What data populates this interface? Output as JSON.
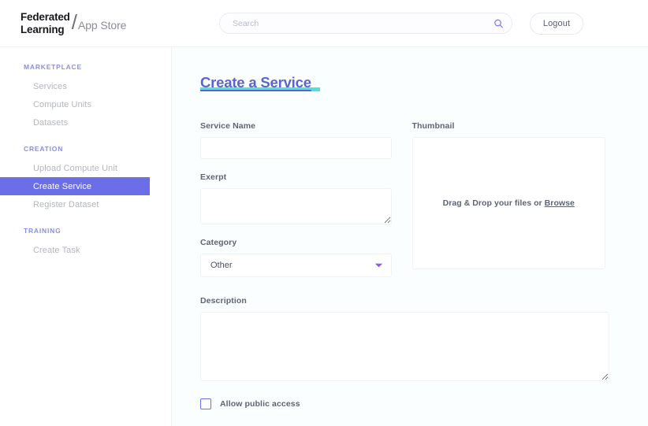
{
  "header": {
    "logo": {
      "line1": "Federated",
      "line2": "Learning",
      "slash": "/",
      "subtitle": "App Store"
    },
    "search": {
      "placeholder": "Search",
      "value": "",
      "icon": "search-icon"
    },
    "logout_label": "Logout"
  },
  "sidebar": {
    "groups": [
      {
        "title": "MARKETPLACE",
        "items": [
          {
            "label": "Services",
            "active": false
          },
          {
            "label": "Compute Units",
            "active": false
          },
          {
            "label": "Datasets",
            "active": false
          }
        ]
      },
      {
        "title": "CREATION",
        "items": [
          {
            "label": "Upload Compute Unit",
            "active": false
          },
          {
            "label": "Create Service",
            "active": true
          },
          {
            "label": "Register Dataset",
            "active": false
          }
        ]
      },
      {
        "title": "TRAINING",
        "items": [
          {
            "label": "Create Task",
            "active": false
          }
        ]
      }
    ]
  },
  "main": {
    "title": "Create a Service",
    "fields": {
      "service_name": {
        "label": "Service Name",
        "value": "",
        "placeholder": ""
      },
      "exerpt": {
        "label": "Exerpt",
        "value": "",
        "placeholder": ""
      },
      "category": {
        "label": "Category",
        "selected": "Other",
        "options": [
          "Other"
        ],
        "caret_icon": "chevron-down-icon"
      },
      "thumbnail": {
        "label": "Thumbnail",
        "drop_text_prefix": "Drag & Drop your files or ",
        "browse_label": "Browse"
      },
      "description": {
        "label": "Description",
        "value": "",
        "placeholder": ""
      },
      "public_access": {
        "label": "Allow public access",
        "checked": false
      }
    }
  },
  "colors": {
    "accent_indigo": "#6a6fe8",
    "title_purple": "#5a63d6",
    "highlight_cyan": "#4fe3d6",
    "nav_heading": "#8a8fe0",
    "content_bg": "#fbfeff",
    "border_light": "#eff3f5"
  }
}
